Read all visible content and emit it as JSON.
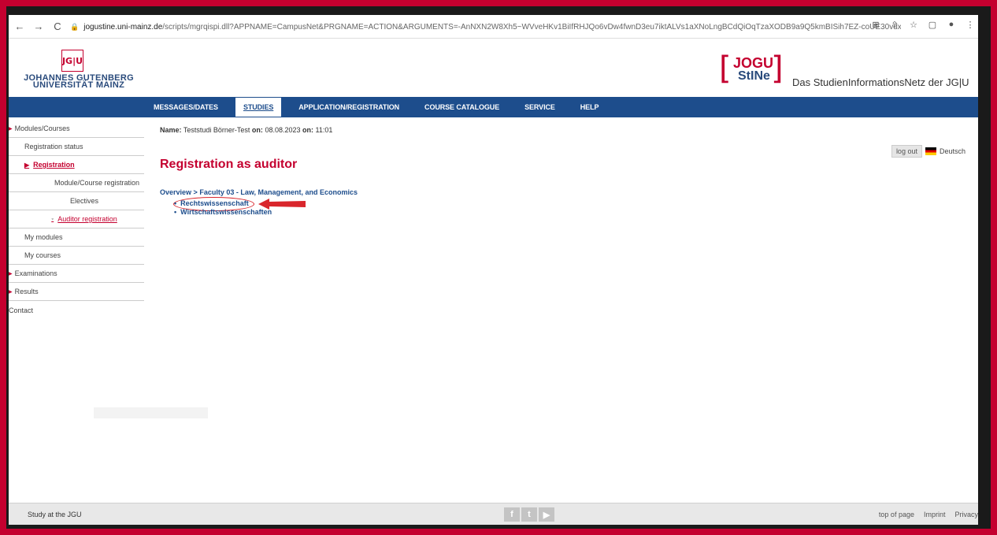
{
  "browser": {
    "url_host": "jogustine.uni-mainz.de",
    "url_rest": "/scripts/mgrqispi.dll?APPNAME=CampusNet&PRGNAME=ACTION&ARGUMENTS=-AnNXN2W8Xh5~WVveHKv1BiIfRHJQo6vDw4fwnD3eu7iktALVs1aXNoLngBCdQiOqTzaXODB9a9Q5kmBISih7EZ-coUE30vdxGs1QdKYrlxNMToy6xzR...",
    "icons": [
      "back-icon",
      "forward-icon",
      "reload-icon",
      "lock-icon",
      "translate-icon",
      "share-icon",
      "star-icon",
      "sidebar-icon",
      "profile-icon",
      "menu-icon"
    ]
  },
  "header": {
    "jgu_mark": "JG|U",
    "jgu_line1": "JOHANNES GUTENBERG",
    "jgu_line2": "UNIVERSITÄT MAINZ",
    "jogu_mark": "JOGU",
    "stine_mark": "StINe",
    "tagline": "Das StudienInformationsNetz der JG|U"
  },
  "mainnav": {
    "items": [
      "MESSAGES/DATES",
      "STUDIES",
      "APPLICATION/REGISTRATION",
      "COURSE CATALOGUE",
      "SERVICE",
      "HELP"
    ],
    "active": "STUDIES"
  },
  "sidebar": {
    "items": [
      "Modules/Courses",
      "Registration status",
      "Registration",
      "Module/Course registration",
      "Electives",
      "Auditor registration",
      "My modules",
      "My courses",
      "Examinations",
      "Results",
      "Contact"
    ]
  },
  "user": {
    "label": "Name:",
    "name": "Teststudi Börner-Test",
    "on_label": "on:",
    "date": "08.08.2023",
    "on2_label": "on:",
    "time": "11:01"
  },
  "top_right": {
    "logout": "log out",
    "language": "Deutsch"
  },
  "content": {
    "title": "Registration as auditor",
    "crumb_overview": "Overview",
    "crumb_sep": ">",
    "crumb_faculty": "Faculty 03 - Law, Management, and Economics",
    "faculties": [
      "Rechtswissenschaft",
      "Wirtschaftswissenschaften"
    ]
  },
  "footer": {
    "left": "Study at the JGU",
    "social": [
      "f",
      "t",
      "▶"
    ],
    "links": [
      "top of page",
      "Imprint",
      "Privacy"
    ]
  },
  "colors": {
    "frame_red": "#c4002f",
    "nav_blue": "#1d4d8c",
    "title_red": "#c4002f"
  }
}
